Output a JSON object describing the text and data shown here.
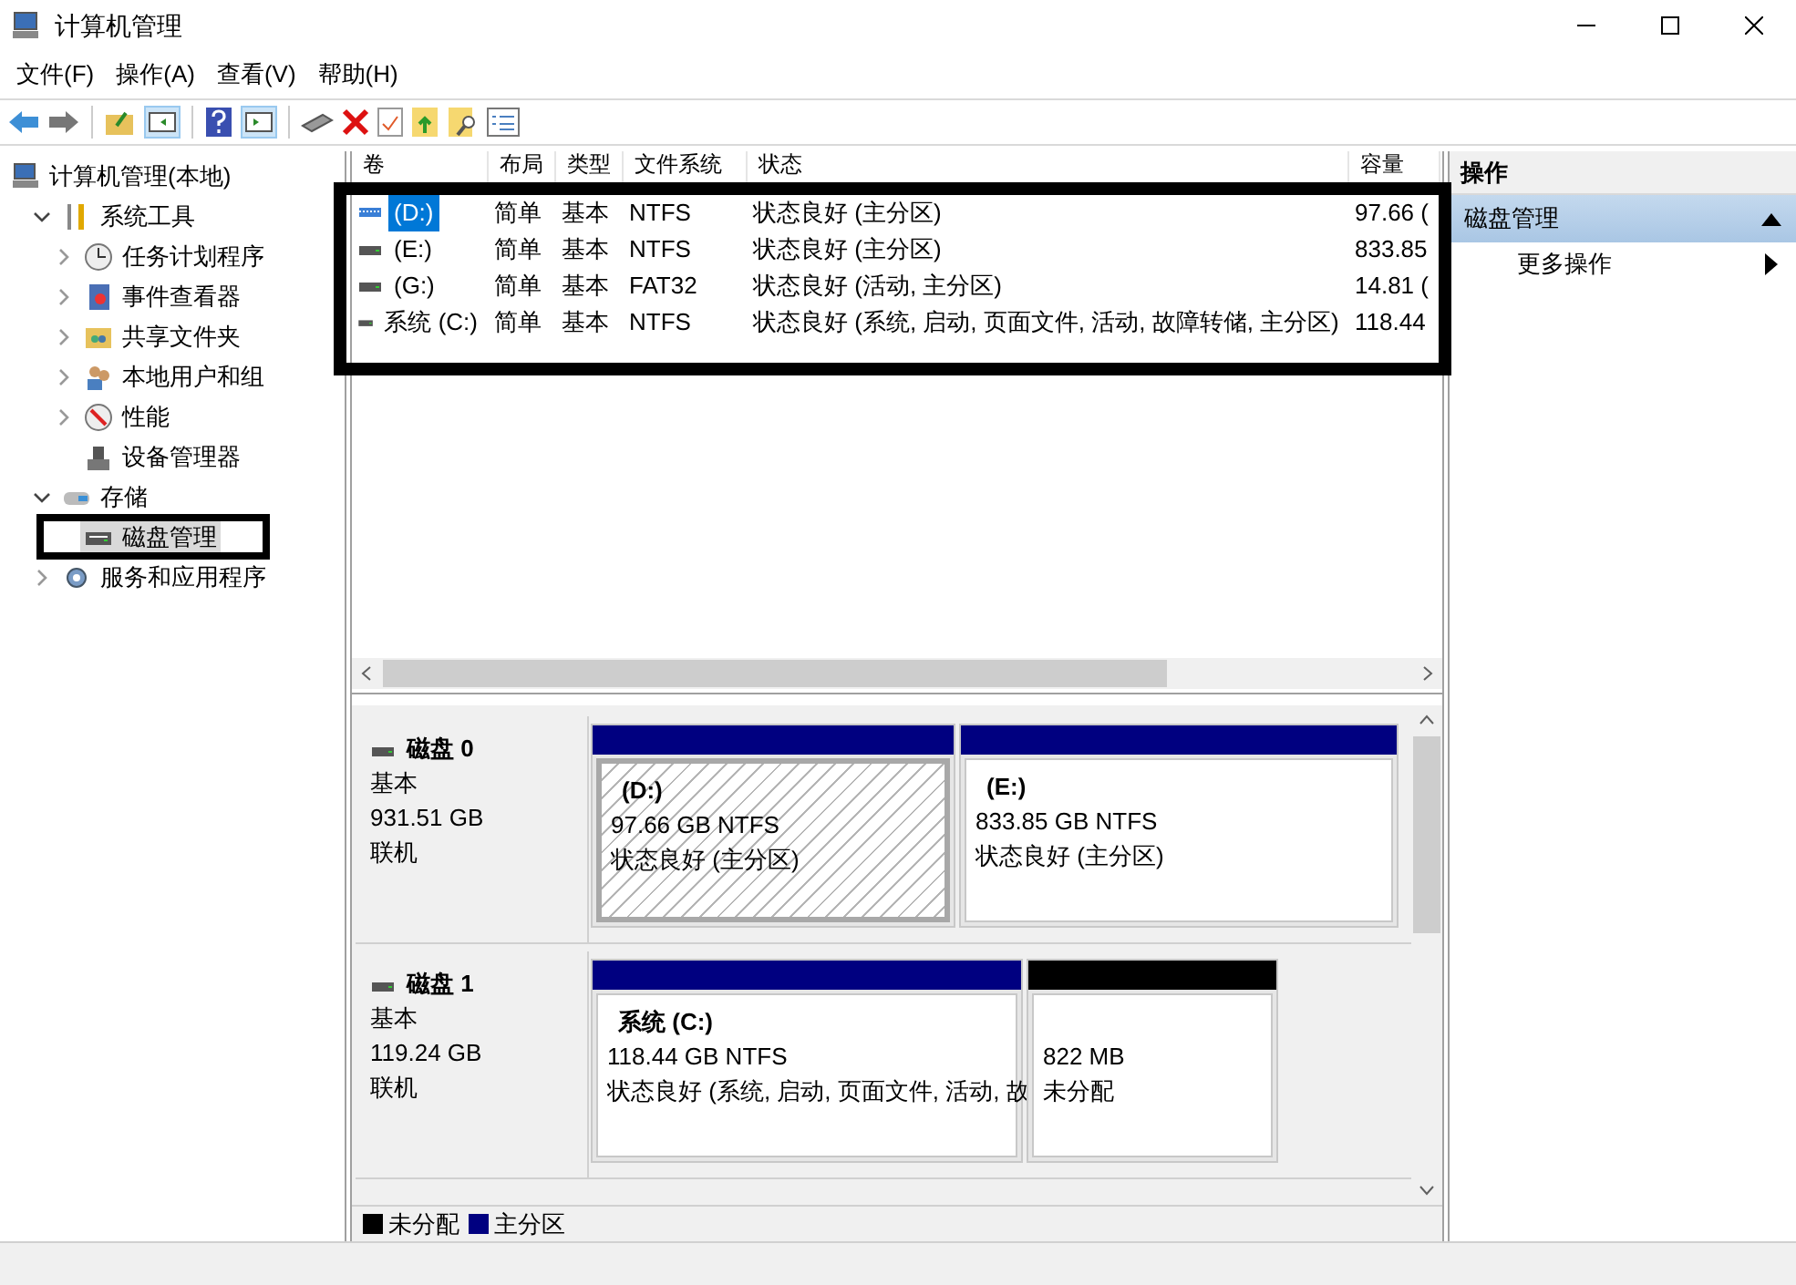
{
  "window": {
    "title": "计算机管理"
  },
  "menu": [
    "文件(F)",
    "操作(A)",
    "查看(V)",
    "帮助(H)"
  ],
  "tree": [
    {
      "label": "计算机管理(本地)",
      "selected": false,
      "children": [
        {
          "label": "系统工具",
          "selected": false,
          "expanded": true,
          "children": [
            {
              "label": "任务计划程序",
              "selected": false,
              "expanded": false
            },
            {
              "label": "事件查看器",
              "selected": false,
              "expanded": false
            },
            {
              "label": "共享文件夹",
              "selected": false,
              "expanded": false
            },
            {
              "label": "本地用户和组",
              "selected": false,
              "expanded": false
            },
            {
              "label": "性能",
              "selected": false,
              "expanded": false
            },
            {
              "label": "设备管理器",
              "selected": false
            }
          ]
        },
        {
          "label": "存储",
          "selected": false,
          "expanded": true,
          "children": [
            {
              "label": "磁盘管理",
              "selected": true
            }
          ]
        },
        {
          "label": "服务和应用程序",
          "selected": false,
          "expanded": false
        }
      ]
    }
  ],
  "volumes": {
    "columns": [
      "卷",
      "布局",
      "类型",
      "文件系统",
      "状态",
      "容量"
    ],
    "rows": [
      {
        "selected": true,
        "cells": [
          "(D:)",
          "简单",
          "基本",
          "NTFS",
          "状态良好 (主分区)",
          "97.66 ("
        ]
      },
      {
        "selected": false,
        "cells": [
          "(E:)",
          "简单",
          "基本",
          "NTFS",
          "状态良好 (主分区)",
          "833.85"
        ]
      },
      {
        "selected": false,
        "cells": [
          "(G:)",
          "简单",
          "基本",
          "FAT32",
          "状态良好 (活动, 主分区)",
          "14.81 ("
        ]
      },
      {
        "selected": false,
        "cells": [
          "系统 (C:)",
          "简单",
          "基本",
          "NTFS",
          "状态良好 (系统, 启动, 页面文件, 活动, 故障转储, 主分区)",
          "118.44"
        ]
      }
    ]
  },
  "disks": [
    {
      "name": "磁盘 0",
      "type": "基本",
      "size": "931.51 GB",
      "status": "联机",
      "partitions": [
        {
          "kind": "primary",
          "selected": true,
          "label": "(D:)",
          "size": "97.66 GB NTFS",
          "status": "状态良好 (主分区)"
        },
        {
          "kind": "primary",
          "selected": false,
          "label": "(E:)",
          "size": "833.85 GB NTFS",
          "status": "状态良好 (主分区)"
        }
      ]
    },
    {
      "name": "磁盘 1",
      "type": "基本",
      "size": "119.24 GB",
      "status": "联机",
      "partitions": [
        {
          "kind": "primary",
          "selected": false,
          "label": "系统  (C:)",
          "size": "118.44 GB NTFS",
          "status": "状态良好 (系统, 启动, 页面文件, 活动, 故"
        },
        {
          "kind": "unallocated",
          "selected": false,
          "size": "822 MB",
          "status": "未分配"
        }
      ]
    }
  ],
  "legend": [
    {
      "label": "未分配",
      "color": "#000000"
    },
    {
      "label": "主分区",
      "color": "#000080"
    }
  ],
  "actions": {
    "title": "操作",
    "section": {
      "label": "磁盘管理",
      "expanded": true
    },
    "items": [
      "更多操作"
    ]
  }
}
